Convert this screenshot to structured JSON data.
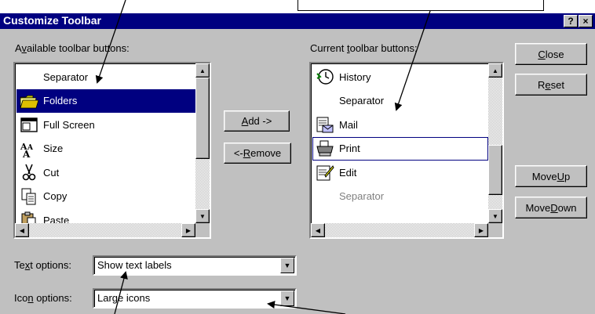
{
  "window": {
    "title": "Customize Toolbar",
    "help_glyph": "?",
    "close_glyph": "×"
  },
  "available": {
    "label_pre": "A",
    "label_ul": "v",
    "label_post": "ailable toolbar buttons:",
    "items": [
      {
        "label": "Separator",
        "icon": "none"
      },
      {
        "label": "Folders",
        "icon": "folder-icon"
      },
      {
        "label": "Full Screen",
        "icon": "full-screen-icon"
      },
      {
        "label": "Size",
        "icon": "size-icon"
      },
      {
        "label": "Cut",
        "icon": "scissors-icon"
      },
      {
        "label": "Copy",
        "icon": "copy-icon"
      },
      {
        "label": "Paste",
        "icon": "paste-icon"
      }
    ],
    "selected": "Folders"
  },
  "current": {
    "label_pre": "Current ",
    "label_ul": "t",
    "label_post": "oolbar buttons:",
    "items": [
      {
        "label": "History",
        "icon": "history-icon"
      },
      {
        "label": "Separator",
        "icon": "none"
      },
      {
        "label": "Mail",
        "icon": "mail-icon"
      },
      {
        "label": "Print",
        "icon": "printer-icon"
      },
      {
        "label": "Edit",
        "icon": "edit-icon"
      },
      {
        "label": "Separator",
        "icon": "none",
        "dimmed": true
      }
    ],
    "focused": "Print"
  },
  "buttons": {
    "add": {
      "ul": "A",
      "post": "dd ->"
    },
    "remove": {
      "pre": "<- ",
      "ul": "R",
      "post": "emove"
    },
    "close": {
      "ul": "C",
      "post": "lose"
    },
    "reset": {
      "pre": "R",
      "ul": "e",
      "post": "set"
    },
    "move_up": {
      "pre": "Move ",
      "ul": "U",
      "post": "p"
    },
    "move_down": {
      "pre": "Move ",
      "ul": "D",
      "post": "own"
    }
  },
  "text_options": {
    "label_pre": "Te",
    "label_ul": "x",
    "label_post": "t options:",
    "value": "Show text labels"
  },
  "icon_options": {
    "label_pre": "Ico",
    "label_ul": "n",
    "label_post": " options:",
    "value": "Large icons"
  },
  "colors": {
    "title_bar": "#000080",
    "face": "#c0c0c0",
    "selection": "#000080"
  }
}
